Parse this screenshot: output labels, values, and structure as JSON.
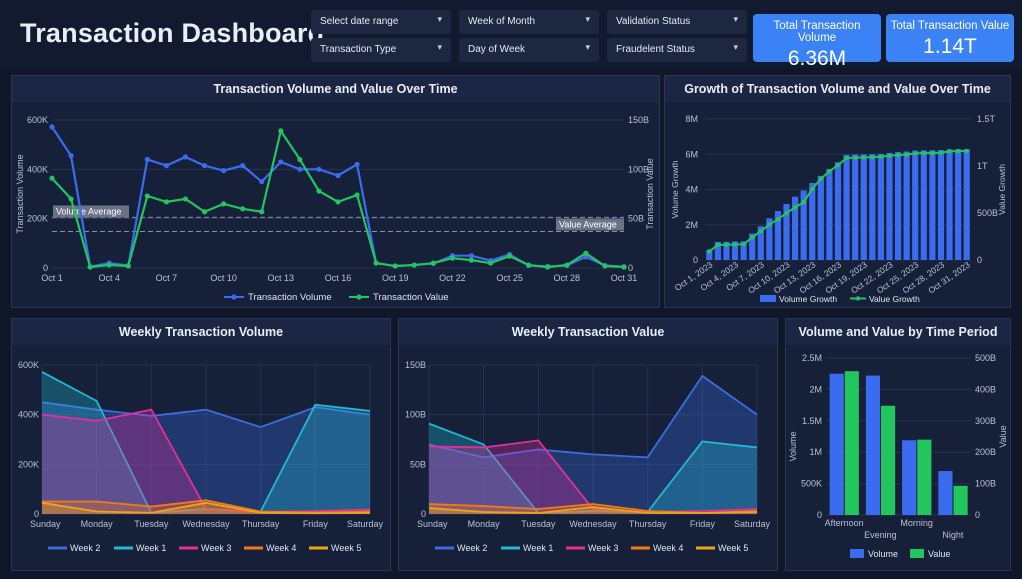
{
  "header": {
    "title": "Transaction Dashboard",
    "filters": [
      {
        "label": "Select date range"
      },
      {
        "label": "Transaction Type"
      },
      {
        "label": "Week of Month"
      },
      {
        "label": "Day of Week"
      },
      {
        "label": "Validation Status"
      },
      {
        "label": "Fraudelent Status"
      }
    ],
    "dropdown_glyph": "▾",
    "kpis": [
      {
        "label": "Total Transaction Volume",
        "value": "6.36M"
      },
      {
        "label": "Total Transaction Value",
        "value": "1.14T"
      }
    ]
  },
  "colors": {
    "accent_blue": "#3b82f6",
    "accent_green": "#22c55e",
    "week1": "#22b8cf",
    "week2": "#3b6ce0",
    "week3": "#e0309a",
    "week4": "#f07a1a",
    "week5": "#f0a21a"
  },
  "panels": {
    "volume_value": {
      "title": "Transaction Volume and Value Over Time"
    },
    "growth": {
      "title": "Growth of Transaction Volume and Value Over Time"
    },
    "weekly_volume": {
      "title": "Weekly Transaction Volume"
    },
    "weekly_value": {
      "title": "Weekly Transaction Value"
    },
    "time_period": {
      "title": "Volume and Value by Time Period"
    }
  },
  "chart_data": [
    {
      "type": "line",
      "title": "Transaction Volume and Value Over Time",
      "x": [
        "Oct 1",
        "Oct 2",
        "Oct 3",
        "Oct 4",
        "Oct 5",
        "Oct 6",
        "Oct 7",
        "Oct 8",
        "Oct 9",
        "Oct 10",
        "Oct 11",
        "Oct 12",
        "Oct 13",
        "Oct 14",
        "Oct 15",
        "Oct 16",
        "Oct 17",
        "Oct 18",
        "Oct 19",
        "Oct 20",
        "Oct 21",
        "Oct 22",
        "Oct 23",
        "Oct 24",
        "Oct 25",
        "Oct 26",
        "Oct 27",
        "Oct 28",
        "Oct 29",
        "Oct 30",
        "Oct 31"
      ],
      "xticks": [
        "Oct 1",
        "Oct 4",
        "Oct 7",
        "Oct 10",
        "Oct 13",
        "Oct 16",
        "Oct 19",
        "Oct 22",
        "Oct 25",
        "Oct 28",
        "Oct 31"
      ],
      "ylabel": "Transaction Volume",
      "y2label": "Transaction Value",
      "yticks": [
        "0",
        "200K",
        "400K",
        "600K"
      ],
      "y2ticks": [
        "0",
        "50B",
        "100B",
        "150B"
      ],
      "ylim": [
        0,
        600000
      ],
      "y2lim": [
        0,
        150000000000
      ],
      "series": [
        {
          "name": "Transaction Volume",
          "axis": "left",
          "color": "#3b6cf0",
          "values": [
            572000,
            455000,
            5000,
            20000,
            10000,
            440000,
            415000,
            450000,
            415000,
            395000,
            415000,
            350000,
            430000,
            400000,
            400000,
            375000,
            420000,
            20000,
            8000,
            12000,
            18000,
            50000,
            50000,
            30000,
            55000,
            10000,
            6000,
            10000,
            45000,
            10000,
            5000
          ]
        },
        {
          "name": "Transaction Value",
          "axis": "right",
          "color": "#22c55e",
          "values": [
            91000000000,
            70000000000,
            1000000000,
            3000000000,
            2000000000,
            73000000000,
            67000000000,
            70000000000,
            57000000000,
            65000000000,
            60000000000,
            57000000000,
            139000000000,
            110000000000,
            78000000000,
            67000000000,
            74000000000,
            5000000000,
            2000000000,
            3000000000,
            5000000000,
            10000000000,
            8000000000,
            5000000000,
            12000000000,
            3000000000,
            1000000000,
            3000000000,
            15000000000,
            2000000000,
            1000000000
          ]
        }
      ],
      "reference_lines": [
        {
          "label": "Volume Average",
          "axis": "left",
          "value": 205000
        },
        {
          "label": "Value Average",
          "axis": "right",
          "value": 37000000000
        }
      ]
    },
    {
      "type": "bar",
      "title": "Growth of Transaction Volume and Value Over Time",
      "xticks": [
        "Oct 1, 2023",
        "Oct 4, 2023",
        "Oct 7, 2023",
        "Oct 10, 2023",
        "Oct 13, 2023",
        "Oct 16, 2023",
        "Oct 19, 2023",
        "Oct 22, 2023",
        "Oct 25, 2023",
        "Oct 28, 2023",
        "Oct 31, 2023"
      ],
      "ylabel": "Volume Growth",
      "y2label": "Value Growth",
      "yticks": [
        "0",
        "2M",
        "4M",
        "6M",
        "8M"
      ],
      "y2ticks": [
        "0",
        "500B",
        "1T",
        "1.5T"
      ],
      "ylim": [
        0,
        8000000
      ],
      "y2lim": [
        0,
        1500000000000
      ],
      "series": [
        {
          "name": "Volume Growth",
          "axis": "left",
          "color": "#3b6cf0",
          "values": [
            572000,
            1027000,
            1032000,
            1052000,
            1062000,
            1502000,
            1917000,
            2367000,
            2782000,
            3177000,
            3592000,
            3942000,
            4372000,
            4772000,
            5172000,
            5547000,
            5967000,
            5987000,
            5995000,
            6007000,
            6025000,
            6075000,
            6125000,
            6155000,
            6210000,
            6220000,
            6226000,
            6236000,
            6281000,
            6291000,
            6296000
          ]
        },
        {
          "name": "Value Growth",
          "axis": "right",
          "color": "#22c55e",
          "values": [
            91000000000,
            161000000000,
            162000000000,
            165000000000,
            167000000000,
            240000000000,
            307000000000,
            377000000000,
            434000000000,
            499000000000,
            559000000000,
            616000000000,
            755000000000,
            865000000000,
            943000000000,
            1010000000000,
            1084000000000,
            1089000000000,
            1091000000000,
            1094000000000,
            1099000000000,
            1109000000000,
            1117000000000,
            1122000000000,
            1134000000000,
            1137000000000,
            1138000000000,
            1141000000000,
            1156000000000,
            1158000000000,
            1159000000000
          ]
        }
      ]
    },
    {
      "type": "area",
      "title": "Weekly Transaction Volume",
      "categories": [
        "Sunday",
        "Monday",
        "Tuesday",
        "Wednesday",
        "Thursday",
        "Friday",
        "Saturday"
      ],
      "yticks": [
        "0",
        "200K",
        "400K",
        "600K"
      ],
      "ylim": [
        0,
        600000
      ],
      "series": [
        {
          "name": "Week 2",
          "color": "#3b6ce0",
          "values": [
            450000,
            420000,
            395000,
            420000,
            350000,
            430000,
            400000
          ]
        },
        {
          "name": "Week 1",
          "color": "#22b8cf",
          "values": [
            572000,
            455000,
            5000,
            20000,
            10000,
            440000,
            415000
          ]
        },
        {
          "name": "Week 3",
          "color": "#e0309a",
          "values": [
            400000,
            375000,
            420000,
            20000,
            8000,
            12000,
            18000
          ]
        },
        {
          "name": "Week 4",
          "color": "#f07a1a",
          "values": [
            50000,
            50000,
            30000,
            55000,
            10000,
            6000,
            10000
          ]
        },
        {
          "name": "Week 5",
          "color": "#f0a21a",
          "values": [
            45000,
            10000,
            5000,
            45000,
            5000,
            3000,
            5000
          ]
        }
      ]
    },
    {
      "type": "area",
      "title": "Weekly Transaction Value",
      "categories": [
        "Sunday",
        "Monday",
        "Tuesday",
        "Wednesday",
        "Thursday",
        "Friday",
        "Saturday"
      ],
      "yticks": [
        "0",
        "50B",
        "100B",
        "150B"
      ],
      "ylim": [
        0,
        150000000000
      ],
      "series": [
        {
          "name": "Week 2",
          "color": "#3b6ce0",
          "values": [
            70000000000,
            57000000000,
            65000000000,
            60000000000,
            57000000000,
            139000000000,
            100000000000
          ]
        },
        {
          "name": "Week 1",
          "color": "#22b8cf",
          "values": [
            91000000000,
            70000000000,
            1000000000,
            3000000000,
            2000000000,
            73000000000,
            67000000000
          ]
        },
        {
          "name": "Week 3",
          "color": "#e0309a",
          "values": [
            68000000000,
            67000000000,
            74000000000,
            5000000000,
            2000000000,
            3000000000,
            5000000000
          ]
        },
        {
          "name": "Week 4",
          "color": "#f07a1a",
          "values": [
            10000000000,
            8000000000,
            5000000000,
            10000000000,
            3000000000,
            1000000000,
            3000000000
          ]
        },
        {
          "name": "Week 5",
          "color": "#f0a21a",
          "values": [
            6000000000,
            2000000000,
            1000000000,
            7000000000,
            1000000000,
            1000000000,
            2000000000
          ]
        }
      ]
    },
    {
      "type": "bar",
      "title": "Volume and Value by Time Period",
      "categories": [
        "Afternoon",
        "Evening",
        "Morning",
        "Night"
      ],
      "ylabel": "Volume",
      "y2label": "Value",
      "yticks": [
        "0",
        "500K",
        "1M",
        "1.5M",
        "2M",
        "2.5M"
      ],
      "y2ticks": [
        "0",
        "100B",
        "200B",
        "300B",
        "400B",
        "500B"
      ],
      "ylim": [
        0,
        2500000
      ],
      "y2lim": [
        0,
        500000000000
      ],
      "series": [
        {
          "name": "Volume",
          "axis": "left",
          "color": "#3b6cf0",
          "values": [
            2250000,
            2220000,
            1190000,
            700000
          ]
        },
        {
          "name": "Value",
          "axis": "right",
          "color": "#22c55e",
          "values": [
            458000000000,
            348000000000,
            240000000000,
            93000000000
          ]
        }
      ]
    }
  ]
}
